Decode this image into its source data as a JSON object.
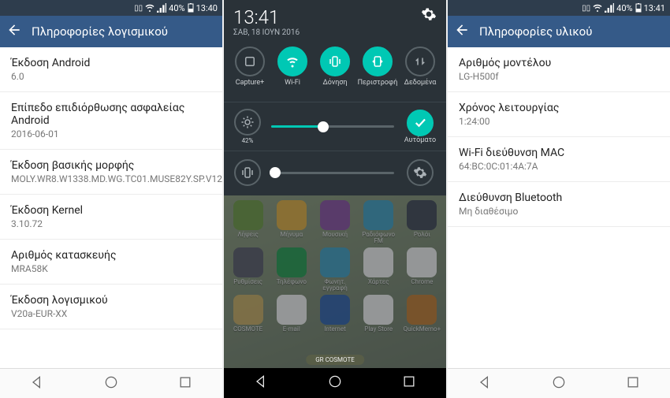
{
  "status": {
    "battery": "40%",
    "time_a": "13:40",
    "time_b": "13:41",
    "time_c": "13:41"
  },
  "panel_a": {
    "header": "Πληροφορίες λογισμικού",
    "rows": [
      {
        "label": "Έκδοση Android",
        "value": "6.0"
      },
      {
        "label": "Επίπεδο επιδιόρθωσης ασφαλείας Android",
        "value": "2016-06-01"
      },
      {
        "label": "Έκδοση βασικής μορφής",
        "value": "MOLY.WR8.W1338.MD.WG.TC01.MUSE82Y.SP.V12"
      },
      {
        "label": "Έκδοση Kernel",
        "value": "3.10.72"
      },
      {
        "label": "Αριθμός κατασκευής",
        "value": "MRA58K"
      },
      {
        "label": "Έκδοση λογισμικού",
        "value": "V20a-EUR-XX"
      }
    ]
  },
  "panel_b": {
    "clock": "13:41",
    "date": "ΣΑΒ, 18 ΙΟΥΝ 2016",
    "toggles": {
      "capture": "Capture+",
      "wifi": "Wi-Fi",
      "vibrate": "Δόνηση",
      "rotate": "Περιστροφή",
      "data": "Δεδομένα"
    },
    "brightness_value": "42%",
    "autobright": "Αυτόματο",
    "carrier": "GR COSMOTE",
    "apps": [
      {
        "label": "Λήψεις",
        "color": "#6b9b3f"
      },
      {
        "label": "Μήνυμα",
        "color": "#e8b13a"
      },
      {
        "label": "Μουσική",
        "color": "#8a4aa5"
      },
      {
        "label": "Ραδιόφωνο FM",
        "color": "#3aa0c9"
      },
      {
        "label": "Ρολόι",
        "color": "#3a4050"
      },
      {
        "label": "Ρυθμίσεις",
        "color": "#556"
      },
      {
        "label": "Τηλέφωνο",
        "color": "#1d9d4c"
      },
      {
        "label": "Φωνητ. εγγραφή",
        "color": "#3aa0c9"
      },
      {
        "label": "Χάρτες",
        "color": "#fff"
      },
      {
        "label": "Chrome",
        "color": "#fff"
      },
      {
        "label": "COSMOTE",
        "color": "#d0b060"
      },
      {
        "label": "E-mail",
        "color": "#fff"
      },
      {
        "label": "Internet",
        "color": "#2a5fb0"
      },
      {
        "label": "Play Store",
        "color": "#fff"
      },
      {
        "label": "QuickMemo+",
        "color": "#c97a2a"
      }
    ]
  },
  "panel_c": {
    "header": "Πληροφορίες υλικού",
    "rows": [
      {
        "label": "Αριθμός μοντέλου",
        "value": "LG-H500f"
      },
      {
        "label": "Χρόνος λειτουργίας",
        "value": "1:24:00"
      },
      {
        "label": "Wi-Fi διεύθυνση MAC",
        "value": "64:BC:0C:01:4A:7A"
      },
      {
        "label": "Διεύθυνση Bluetooth",
        "value": "Μη διαθέσιμο"
      }
    ]
  }
}
